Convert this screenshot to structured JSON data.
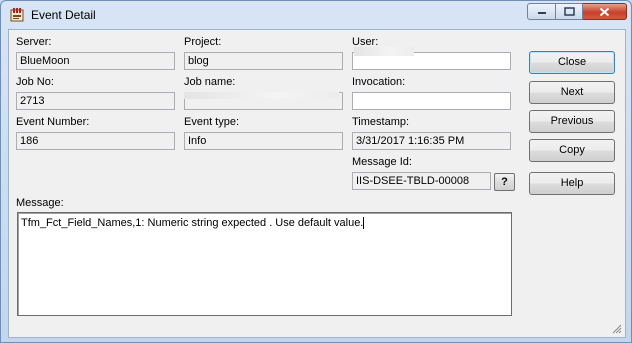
{
  "window": {
    "title": "Event Detail",
    "icon": "app-icon"
  },
  "fields": {
    "server": {
      "label": "Server:",
      "value": "BlueMoon"
    },
    "project": {
      "label": "Project:",
      "value": "blog"
    },
    "user": {
      "label": "User:",
      "value": ""
    },
    "job_no": {
      "label": "Job No:",
      "value": "2713"
    },
    "job_name": {
      "label": "Job name:",
      "value": ""
    },
    "invocation": {
      "label": "Invocation:",
      "value": ""
    },
    "event_number": {
      "label": "Event Number:",
      "value": "186"
    },
    "event_type": {
      "label": "Event type:",
      "value": "Info"
    },
    "timestamp": {
      "label": "Timestamp:",
      "value": "3/31/2017 1:16:35 PM"
    },
    "message_id": {
      "label": "Message Id:",
      "value": "IIS-DSEE-TBLD-00008",
      "help_label": "?"
    },
    "message": {
      "label": "Message:",
      "value": "Tfm_Fct_Field_Names,1: Numeric string expected . Use default value."
    }
  },
  "buttons": {
    "close": "Close",
    "next": "Next",
    "previous": "Previous",
    "copy": "Copy",
    "help": "Help"
  }
}
